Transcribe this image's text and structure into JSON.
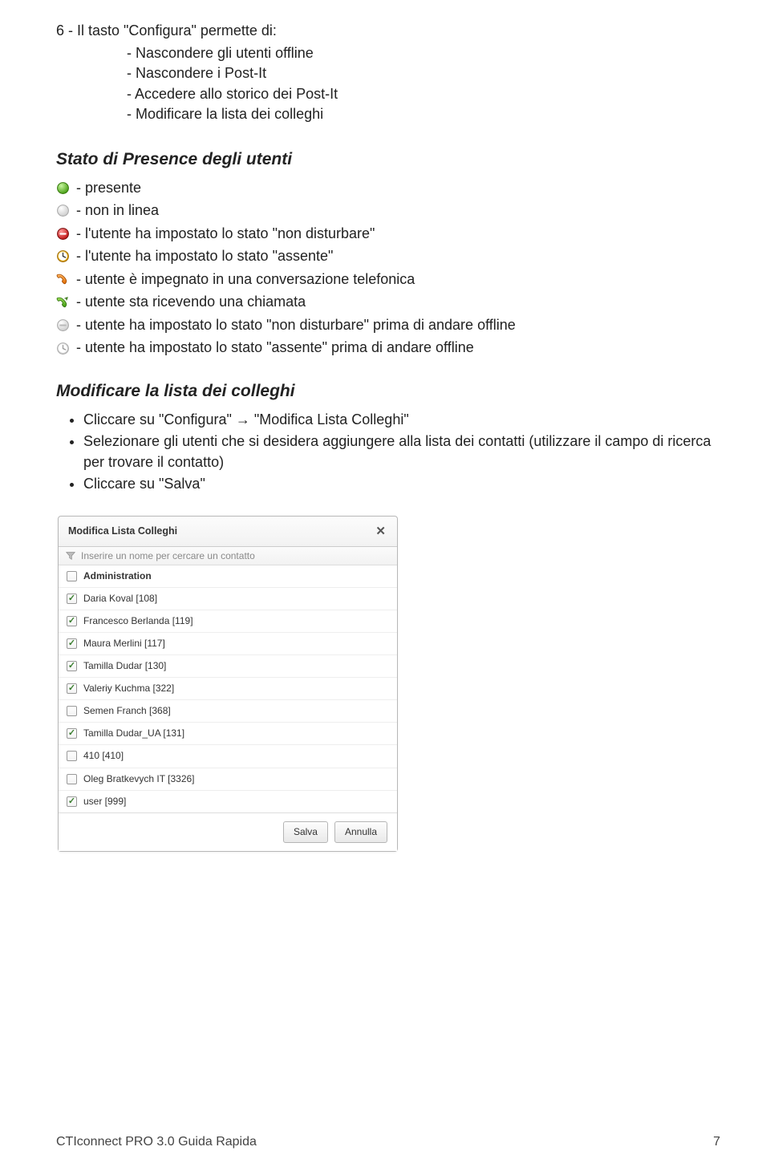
{
  "intro": {
    "lead": "6 - Il tasto \"Configura\" permette di:",
    "items": [
      "- Nascondere gli utenti offline",
      "- Nascondere i Post-It",
      "- Accedere allo storico dei Post-It",
      "- Modificare la lista dei colleghi"
    ]
  },
  "presence": {
    "heading": "Stato di Presence degli utenti",
    "rows": [
      {
        "icon": "dot-green",
        "text": " - presente"
      },
      {
        "icon": "dot-grey",
        "text": " - non in linea"
      },
      {
        "icon": "dnd-red",
        "text": " - l'utente ha impostato lo stato \"non disturbare\""
      },
      {
        "icon": "clock-yellow",
        "text": " - l'utente ha impostato lo stato \"assente\""
      },
      {
        "icon": "phone-orange",
        "text": " - utente è impegnato in una conversazione telefonica"
      },
      {
        "icon": "phone-green",
        "text": " - utente sta ricevendo una chiamata"
      },
      {
        "icon": "dnd-grey",
        "text": " - utente ha impostato lo stato \"non disturbare\" prima di andare offline"
      },
      {
        "icon": "clock-grey",
        "text": " - utente ha impostato lo stato \"assente\" prima di andare offline"
      }
    ]
  },
  "modify": {
    "heading": "Modificare la lista dei colleghi",
    "bullets": [
      "Cliccare su \"Configura\" → \"Modifica Lista Colleghi\"",
      "Selezionare gli utenti che si desidera aggiungere alla lista dei contatti (utilizzare il campo di ricerca per trovare il contatto)",
      "Cliccare su \"Salva\""
    ]
  },
  "dialog": {
    "title": "Modifica Lista Colleghi",
    "search_placeholder": "Inserire un nome per cercare un contatto",
    "rows": [
      {
        "checked": false,
        "label": "Administration",
        "group": true
      },
      {
        "checked": true,
        "label": "Daria Koval [108]"
      },
      {
        "checked": true,
        "label": "Francesco Berlanda [119]"
      },
      {
        "checked": true,
        "label": "Maura Merlini [117]"
      },
      {
        "checked": true,
        "label": "Tamilla Dudar [130]"
      },
      {
        "checked": true,
        "label": "Valeriy Kuchma [322]"
      },
      {
        "checked": false,
        "label": "Semen Franch [368]"
      },
      {
        "checked": true,
        "label": "Tamilla Dudar_UA [131]"
      },
      {
        "checked": false,
        "label": "410 [410]"
      },
      {
        "checked": false,
        "label": "Oleg Bratkevych IT [3326]"
      },
      {
        "checked": true,
        "label": "user [999]"
      }
    ],
    "save": "Salva",
    "cancel": "Annulla"
  },
  "footer": {
    "left": "CTIconnect PRO 3.0 Guida Rapida",
    "right": "7"
  }
}
